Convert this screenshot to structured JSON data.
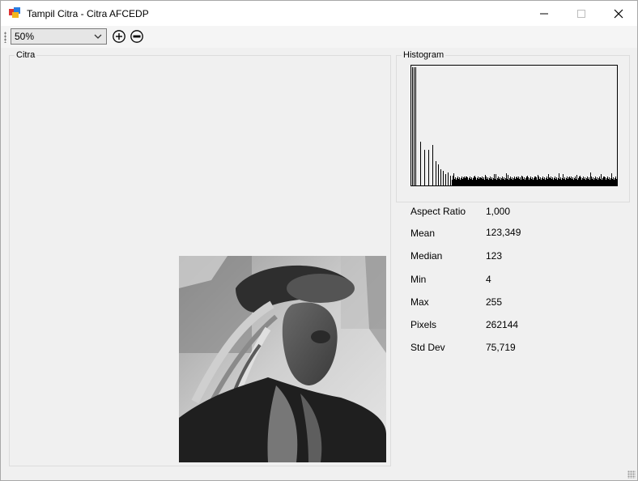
{
  "window": {
    "title": "Tampil Citra - Citra AFCEDP",
    "minimize_glyph": "—",
    "maximize_glyph": "☐",
    "close_glyph": "✕"
  },
  "toolbar": {
    "zoom_value": "50%",
    "zoom_in_icon": "circle-plus-icon",
    "zoom_out_icon": "circle-minus-icon"
  },
  "citra_panel": {
    "label": "Citra",
    "image_description_icon": "grayscale-photo"
  },
  "histogram_panel": {
    "label": "Histogram"
  },
  "stats": [
    {
      "label": "Aspect Ratio",
      "value": "1,000"
    },
    {
      "label": "Mean",
      "value": "123,349"
    },
    {
      "label": "Median",
      "value": "123"
    },
    {
      "label": "Min",
      "value": "4"
    },
    {
      "label": "Max",
      "value": "255"
    },
    {
      "label": "Pixels",
      "value": "262144"
    },
    {
      "label": "Std Dev",
      "value": "75,719"
    }
  ]
}
